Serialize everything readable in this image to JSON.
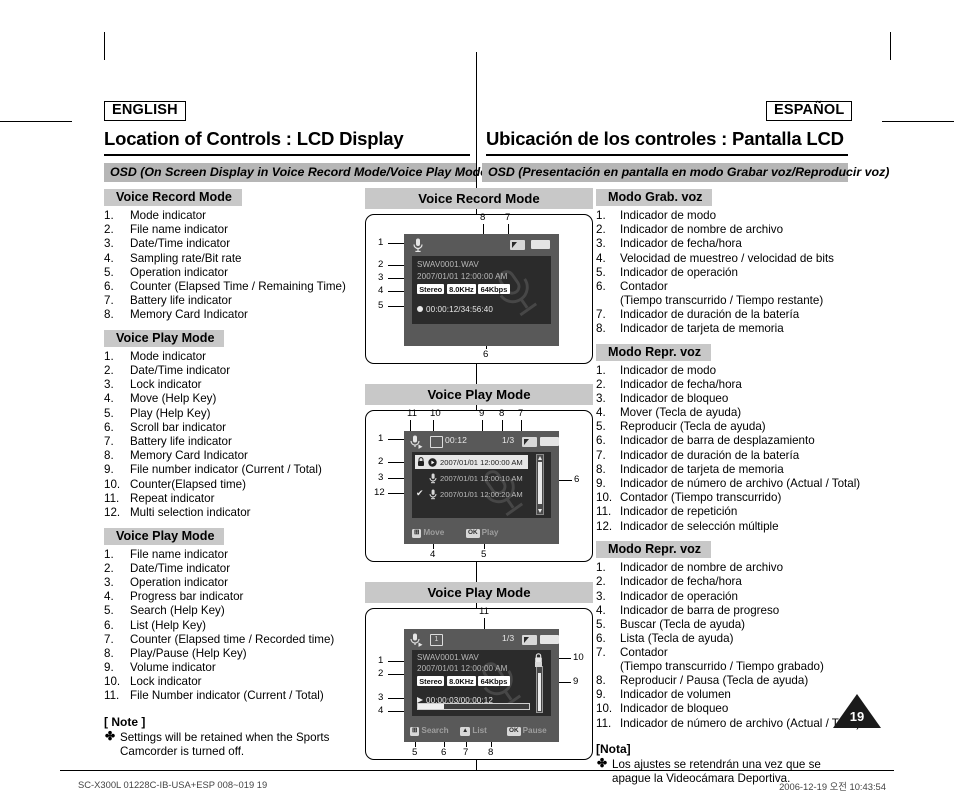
{
  "page": {
    "number": "19",
    "language_left": "ENGLISH",
    "language_right": "ESPAÑOL",
    "title_left": "Location of Controls : LCD Display",
    "title_right": "Ubicación de los controles : Pantalla LCD",
    "osd_left": "OSD (On Screen Display in Voice Record Mode/Voice Play Mode)",
    "osd_right": "OSD (Presentación en pantalla en modo Grabar voz/Reproducir voz)"
  },
  "footer": {
    "left": "SC-X300L 01228C-IB-USA+ESP 008~019   19",
    "right": "2006-12-19   오전 10:43:54"
  },
  "english": {
    "sections": [
      {
        "heading": "Voice Record Mode",
        "items": [
          "Mode indicator",
          "File name indicator",
          "Date/Time indicator",
          "Sampling rate/Bit rate",
          "Operation indicator",
          "Counter (Elapsed Time / Remaining Time)",
          "Battery life indicator",
          "Memory Card Indicator"
        ]
      },
      {
        "heading": "Voice Play Mode",
        "items": [
          "Mode indicator",
          "Date/Time indicator",
          "Lock indicator",
          "Move (Help Key)",
          "Play (Help Key)",
          "Scroll bar indicator",
          "Battery life indicator",
          "Memory Card Indicator",
          "File number indicator (Current / Total)",
          "Counter(Elapsed time)",
          "Repeat indicator",
          "Multi selection indicator"
        ]
      },
      {
        "heading": "Voice Play Mode",
        "items": [
          "File name indicator",
          "Date/Time indicator",
          "Operation indicator",
          "Progress bar indicator",
          "Search (Help Key)",
          "List (Help Key)",
          "Counter (Elapsed time / Recorded time)",
          "Play/Pause (Help Key)",
          "Volume indicator",
          "Lock indicator",
          "File Number indicator (Current / Total)"
        ]
      }
    ],
    "note_title": "[ Note ]",
    "note_bullet": "✤",
    "note_text": "Settings will be retained when the Sports Camcorder is turned off."
  },
  "spanish": {
    "sections": [
      {
        "heading": "Modo Grab. voz",
        "items": [
          "Indicador de modo",
          "Indicador de nombre de archivo",
          "Indicador de fecha/hora",
          "Velocidad de muestreo / velocidad de bits",
          "Indicador de operación",
          "Contador\n(Tiempo transcurrido / Tiempo restante)",
          "Indicador de duración de la batería",
          "Indicador de tarjeta de memoria"
        ]
      },
      {
        "heading": "Modo Repr. voz",
        "items": [
          "Indicador de modo",
          "Indicador de fecha/hora",
          "Indicador de bloqueo",
          "Mover (Tecla de ayuda)",
          "Reproducir (Tecla de ayuda)",
          "Indicador de barra de desplazamiento",
          "Indicador de duración de la batería",
          "Indicador de tarjeta de memoria",
          "Indicador de número de archivo (Actual / Total)",
          "Contador (Tiempo transcurrido)",
          "Indicador de repetición",
          "Indicador de selección múltiple"
        ]
      },
      {
        "heading": "Modo Repr. voz",
        "items": [
          "Indicador de nombre de archivo",
          "Indicador de fecha/hora",
          "Indicador de operación",
          "Indicador de barra de progreso",
          "Buscar (Tecla de ayuda)",
          "Lista (Tecla de ayuda)",
          "Contador\n(Tiempo transcurrido / Tiempo grabado)",
          "Reproducir / Pausa (Tecla de ayuda)",
          "Indicador de volumen",
          "Indicador de bloqueo",
          "Indicador de número de archivo (Actual / Total)"
        ]
      }
    ],
    "note_title": "[Nota]",
    "note_bullet": "✤",
    "note_text": "Los ajustes se retendrán una vez que se apague la Videocámara Deportiva."
  },
  "screens": {
    "record": {
      "caption": "Voice Record Mode",
      "filename": "SWAV0001.WAV",
      "datetime": "2007/01/01 12:00:00 AM",
      "chip_channel": "Stereo",
      "chip_rate": "8.0KHz",
      "chip_bitrate": "64Kbps",
      "counter": "00:00:12/34:56:40",
      "callouts": [
        "1",
        "2",
        "3",
        "4",
        "5",
        "6",
        "7",
        "8"
      ]
    },
    "play_list": {
      "caption": "Voice Play Mode",
      "counter": "00:12",
      "file_number": "1/3",
      "rows": [
        "2007/01/01 12:00:00 AM",
        "2007/01/01 12:00:10 AM",
        "2007/01/01 12:00:20 AM"
      ],
      "help_move": "Move",
      "help_play": "Play",
      "key_move": "⊞",
      "key_ok": "OK",
      "callouts": [
        "1",
        "2",
        "3",
        "4",
        "5",
        "6",
        "7",
        "8",
        "9",
        "10",
        "11",
        "12"
      ]
    },
    "play_detail": {
      "caption": "Voice Play Mode",
      "file_number": "1/3",
      "filename": "SWAV0001.WAV",
      "datetime": "2007/01/01 12:00:00 AM",
      "chip_channel": "Stereo",
      "chip_rate": "8.0KHz",
      "chip_bitrate": "64Kbps",
      "counter": "00:00:03/00:00:12",
      "help_search": "Search",
      "help_list": "List",
      "help_pause": "Pause",
      "key_search": "⊞",
      "key_list": "▲",
      "key_ok": "OK",
      "callouts": [
        "1",
        "2",
        "3",
        "4",
        "5",
        "6",
        "7",
        "8",
        "9",
        "10",
        "11"
      ]
    }
  },
  "colors": {
    "gray_bar": "#b6b6b6",
    "chip_bg": "#c8c8c8",
    "lcd_body": "#595959",
    "lcd_inner": "#2b2b2b",
    "lcd_text": "#b9b9b9"
  }
}
